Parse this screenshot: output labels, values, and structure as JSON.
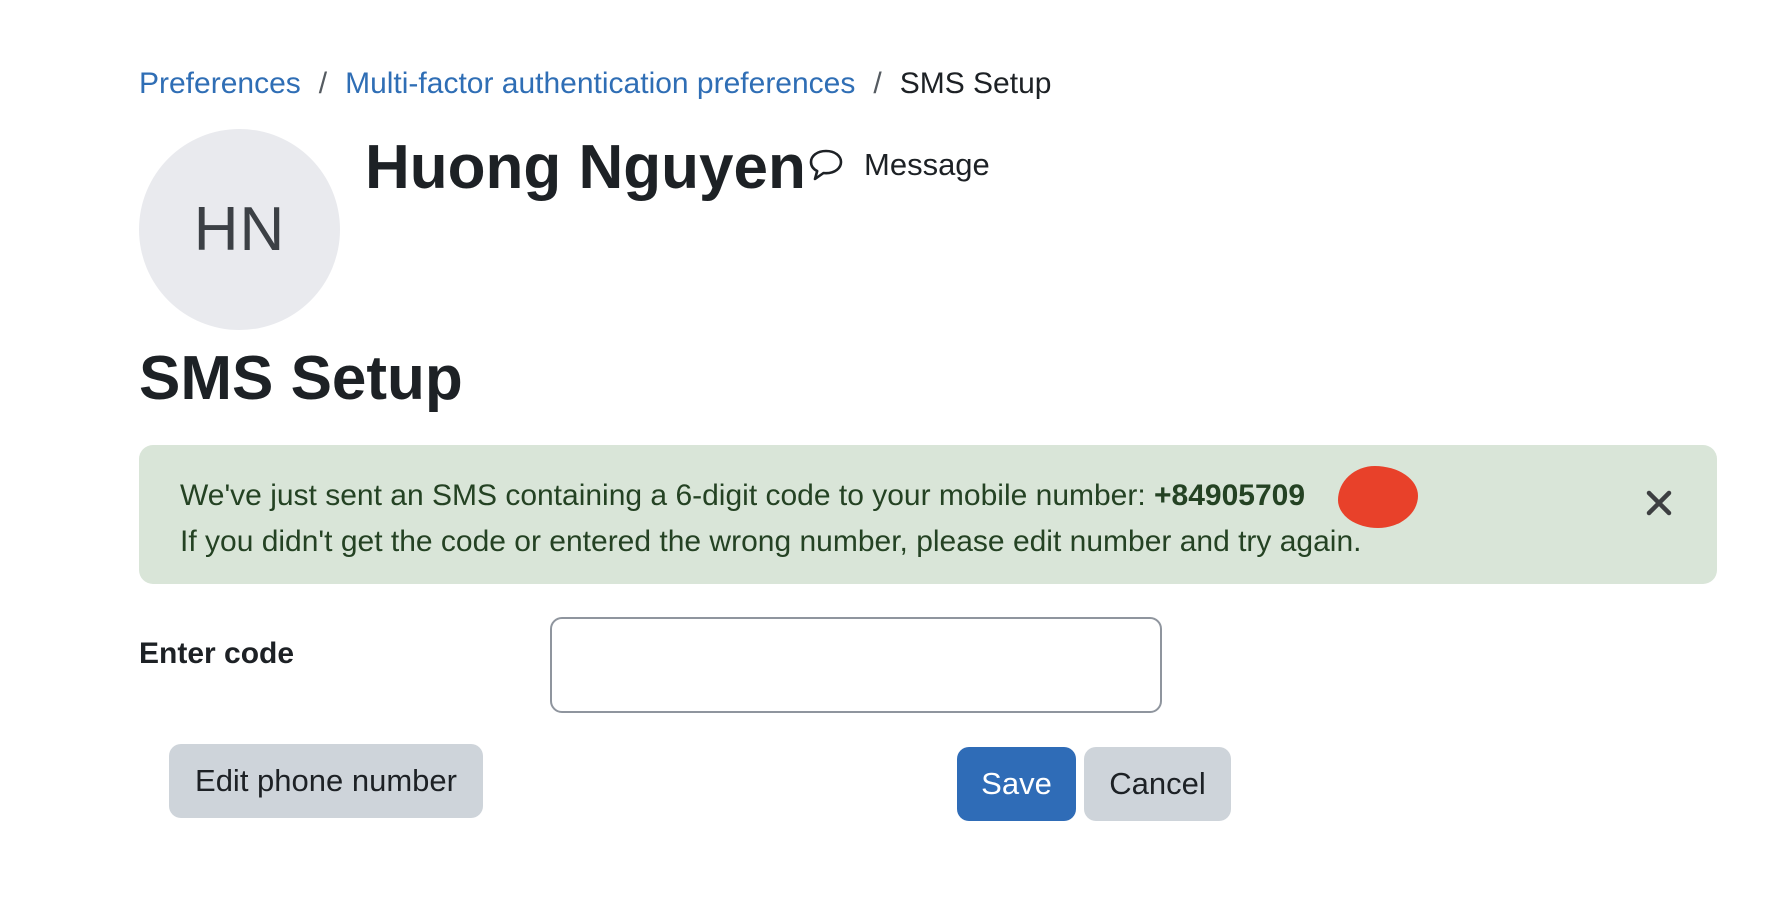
{
  "breadcrumb": {
    "items": [
      {
        "label": "Preferences"
      },
      {
        "label": "Multi-factor authentication preferences"
      },
      {
        "label": "SMS Setup"
      }
    ],
    "separator": "/"
  },
  "header": {
    "avatar_initials": "HN",
    "user_name": "Huong Nguyen",
    "message_label": "Message",
    "message_icon": "speech-bubble-icon"
  },
  "page": {
    "heading": "SMS Setup"
  },
  "alert": {
    "line1_text": "We've just sent an SMS containing a 6-digit code to your mobile number: ",
    "phone_number": "+84905709",
    "line2_text": "If you didn't get the code or entered the wrong number, please edit number and try again.",
    "close_icon": "close-icon",
    "background_color": "#d9e5d8"
  },
  "form": {
    "code_label": "Enter code",
    "code_value": "",
    "edit_phone_label": "Edit phone number",
    "save_label": "Save",
    "cancel_label": "Cancel"
  },
  "colors": {
    "link": "#2f6eb5",
    "primary_button": "#2f6cb7",
    "secondary_button": "#ced4da",
    "redaction": "#e8412a"
  }
}
